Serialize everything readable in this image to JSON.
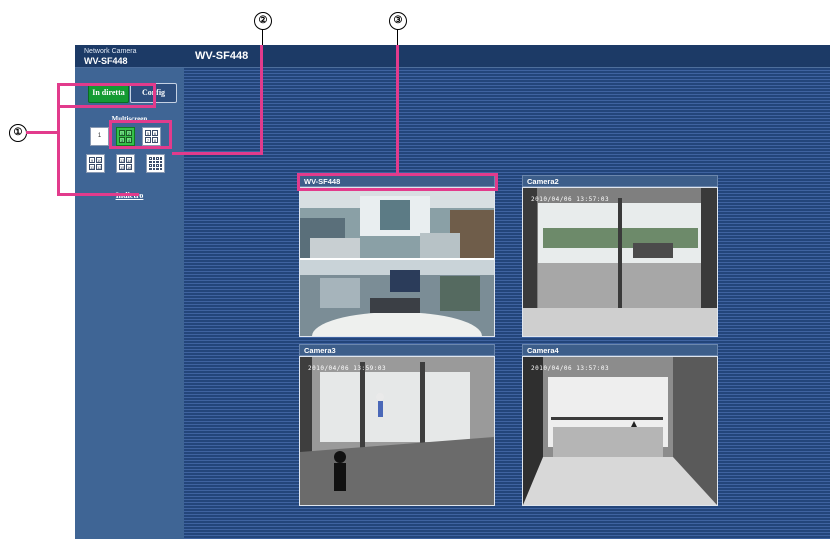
{
  "header": {
    "brand_line1": "Network Camera",
    "brand_model": "WV-SF448",
    "title": "WV-SF448"
  },
  "sidebar": {
    "tabs": [
      {
        "label": "In diretta",
        "active": true
      },
      {
        "label": "Config",
        "active": false
      }
    ],
    "multiscreen_label": "Multiscreen",
    "multiscreen_buttons": [
      {
        "name": "single",
        "cells": [
          "1"
        ],
        "active": false
      },
      {
        "name": "quad-1",
        "cells": [
          "1",
          "2",
          "3",
          "4"
        ],
        "active": true
      },
      {
        "name": "quad-2",
        "cells": [
          "5",
          "6",
          "7",
          "8"
        ],
        "active": false
      },
      {
        "name": "quad-3",
        "cells": [
          "9",
          "10",
          "11",
          "12"
        ],
        "active": false
      },
      {
        "name": "quad-4",
        "cells": [
          "13",
          "14",
          "15",
          "16"
        ],
        "active": false
      },
      {
        "name": "sixteen",
        "cells": [
          "1",
          "2",
          "3",
          "4",
          "5",
          "6",
          "7",
          "8",
          "9",
          "10",
          "11",
          "12",
          "13",
          "14",
          "15",
          "16"
        ],
        "active": false
      }
    ],
    "back_link": "Indietro"
  },
  "cameras": [
    {
      "title": "WV-SF448",
      "timestamp": ""
    },
    {
      "title": "Camera2",
      "timestamp": "2010/04/06 13:57:03"
    },
    {
      "title": "Camera3",
      "timestamp": "2010/04/06 13:59:03"
    },
    {
      "title": "Camera4",
      "timestamp": "2010/04/06 13:57:03"
    }
  ],
  "callouts": [
    "①",
    "②",
    "③"
  ],
  "colors": {
    "accent_pink": "#e23b8c",
    "live_green": "#149b33",
    "frame_blue": "#1f3f6c"
  }
}
